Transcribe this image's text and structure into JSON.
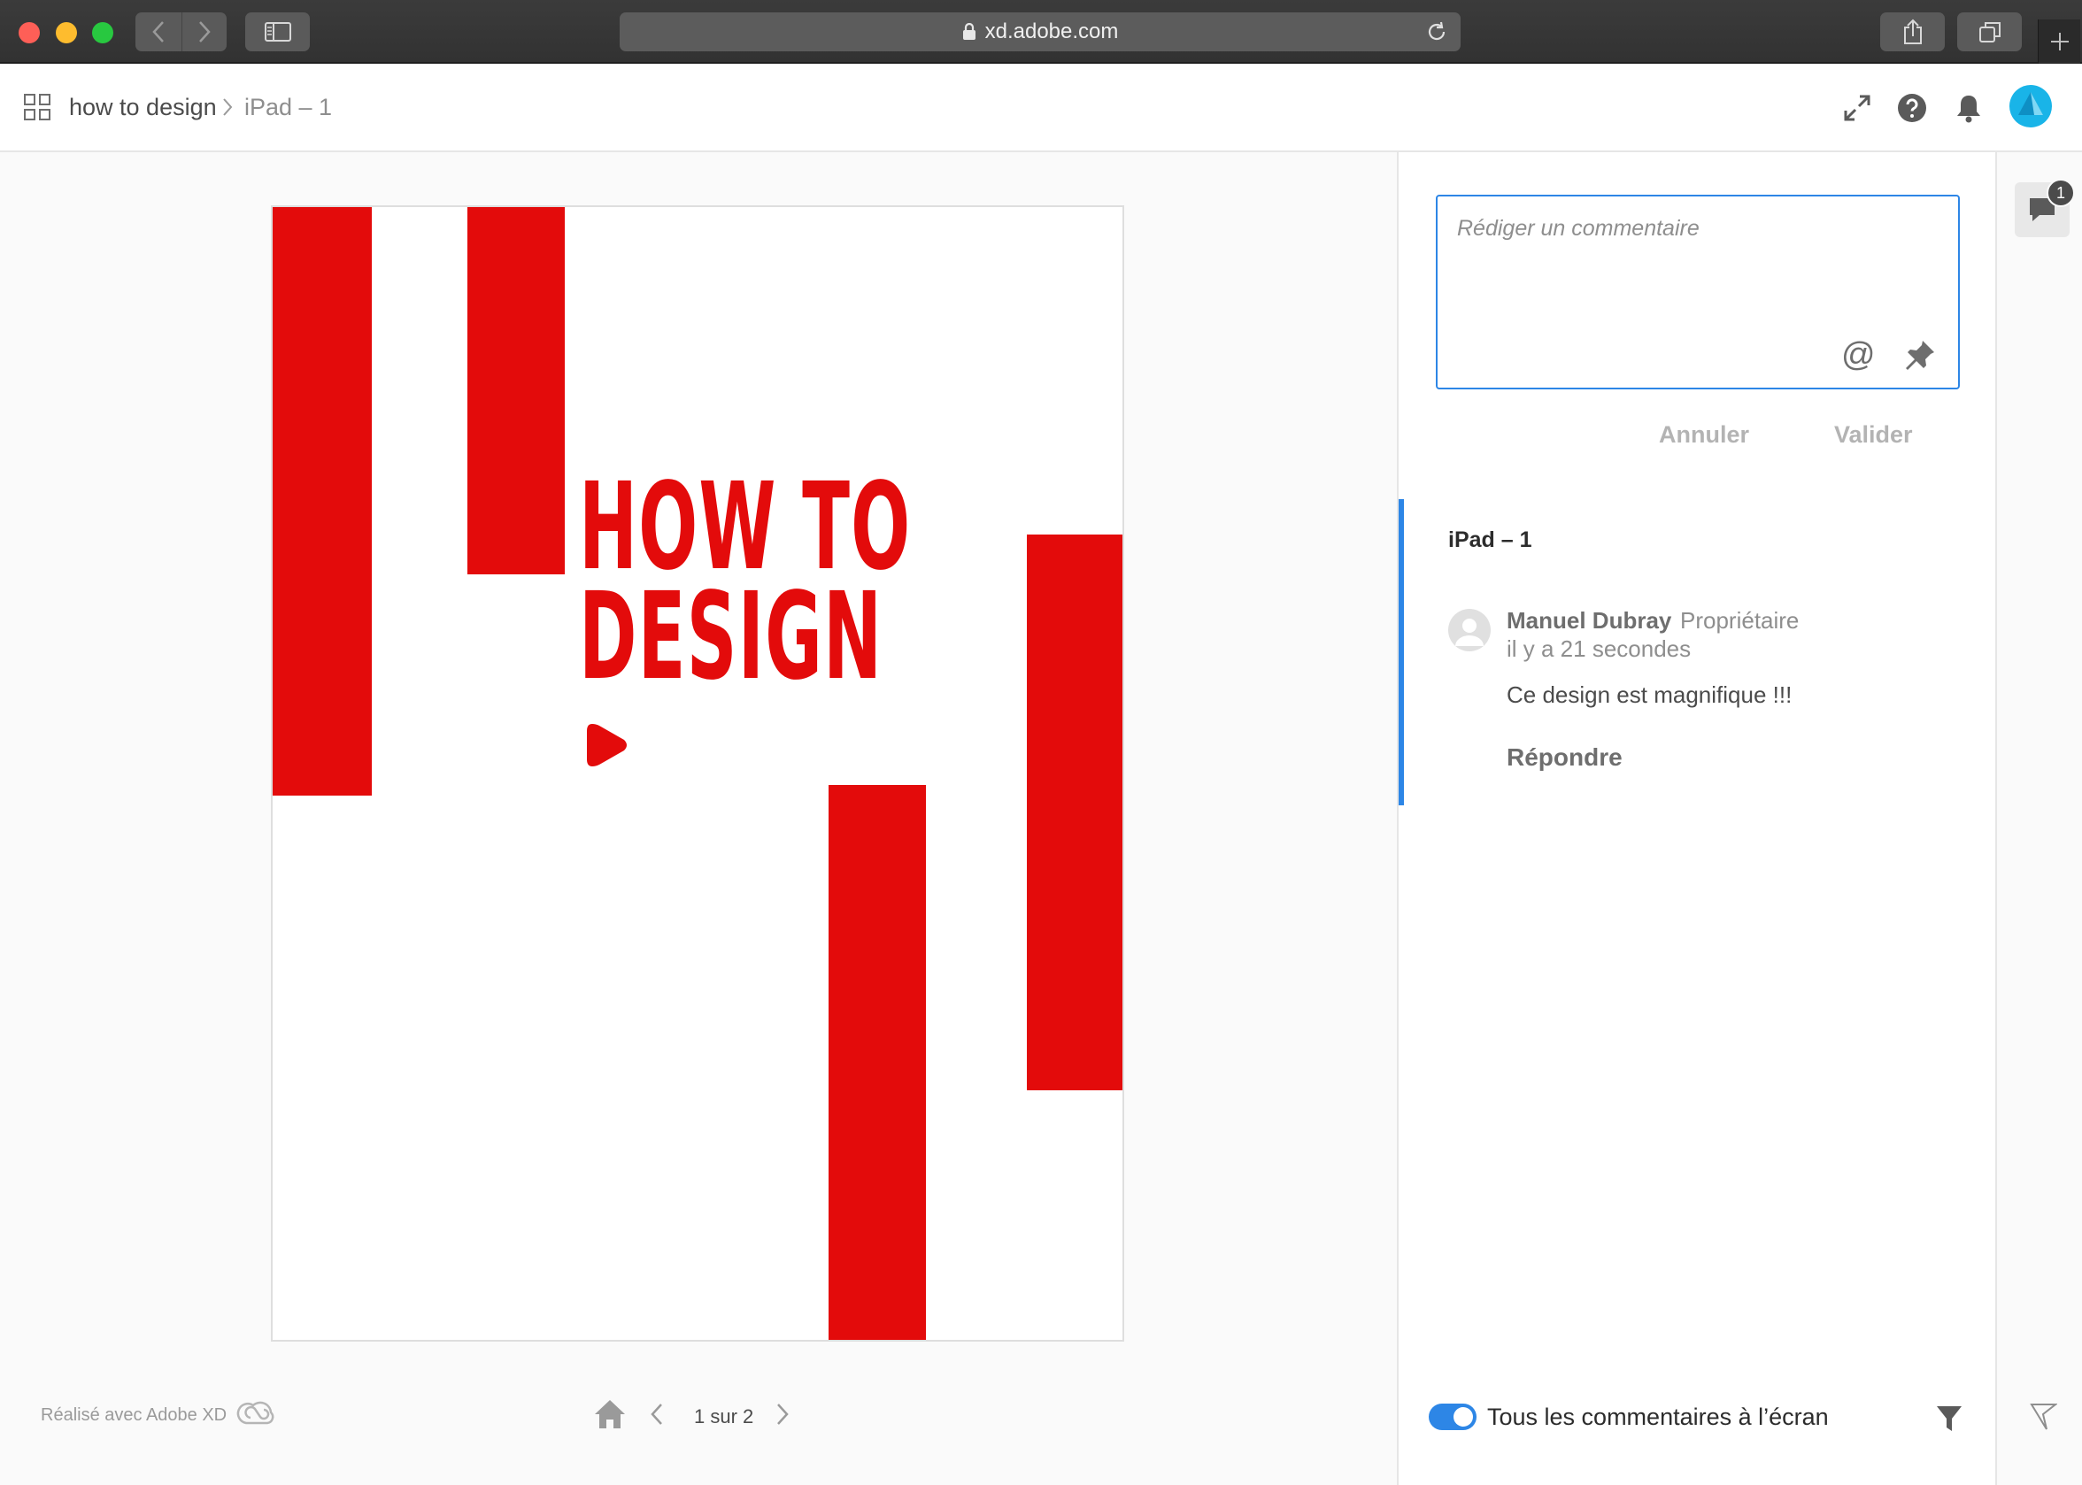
{
  "browser": {
    "url": "xd.adobe.com"
  },
  "header": {
    "breadcrumb_doc": "how to design",
    "breadcrumb_page": "iPad – 1"
  },
  "artboard": {
    "title_line1": "HOW TO",
    "title_line2": "DESIGN",
    "accent_color": "#e30b0b"
  },
  "footer": {
    "made_with": "Réalisé avec Adobe XD",
    "pager": "1 sur 2"
  },
  "comments": {
    "placeholder": "Rédiger un commentaire",
    "cancel_label": "Annuler",
    "submit_label": "Valider",
    "thread_title": "iPad – 1",
    "author": "Manuel Dubray",
    "role": "Propriétaire",
    "time": "il y a 21 secondes",
    "text": "Ce design est magnifique !!!",
    "reply_label": "Répondre",
    "show_all_label": "Tous les commentaires à l’écran",
    "count": "1"
  },
  "colors": {
    "accent_blue": "#2d86e6",
    "avatar_cyan": "#19b4e8"
  }
}
